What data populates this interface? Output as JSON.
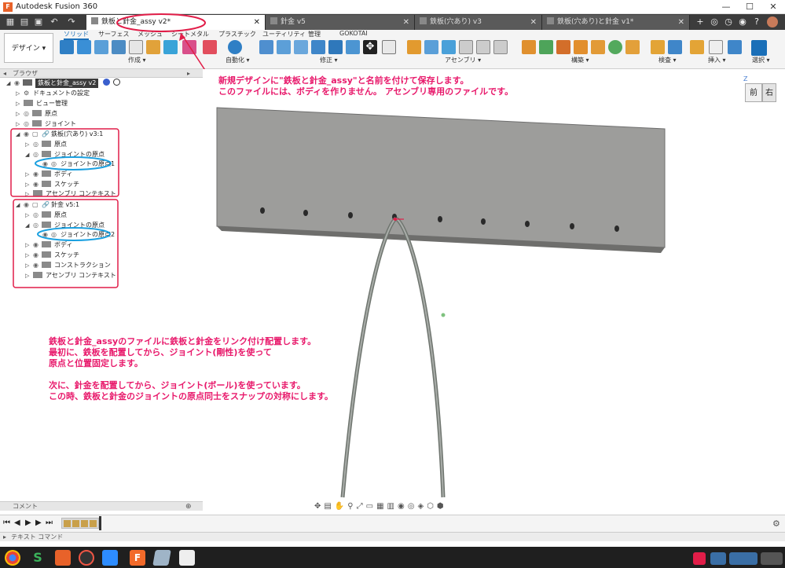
{
  "window": {
    "app_title": "Autodesk Fusion 360",
    "controls": {
      "minimize": "—",
      "maximize": "☐",
      "close": "✕"
    }
  },
  "tabs": [
    {
      "label": "鉄板と針金_assy v2*",
      "active": true
    },
    {
      "label": "針金 v5",
      "active": false
    },
    {
      "label": "鉄板(穴あり) v3",
      "active": false
    },
    {
      "label": "鉄板(穴あり)と針金 v1*",
      "active": false
    }
  ],
  "ribbon": {
    "design_label": "デザイン ▾",
    "tabs": [
      "ソリッド",
      "サーフェス",
      "メッシュ",
      "シートメタル",
      "プラスチック",
      "ユーティリティ",
      "管理",
      "GOKOTAI"
    ],
    "groups": [
      "作成 ▾",
      "自動化 ▾",
      "修正 ▾",
      "アセンブリ ▾",
      "構築 ▾",
      "検査 ▾",
      "挿入 ▾",
      "選択 ▾"
    ]
  },
  "browser": {
    "title": "ブラウザ",
    "root_label": "鉄板と針金_assy v2",
    "items": [
      {
        "label": "ドキュメントの設定"
      },
      {
        "label": "ビュー管理"
      },
      {
        "label": "原点"
      },
      {
        "label": "ジョイント"
      },
      {
        "label": "鉄板(穴あり) v3:1"
      },
      {
        "label": "原点"
      },
      {
        "label": "ジョイントの原点"
      },
      {
        "label": "ジョイントの原点1"
      },
      {
        "label": "ボディ"
      },
      {
        "label": "スケッチ"
      },
      {
        "label": "アセンブリ コンテキスト"
      },
      {
        "label": "針金 v5:1"
      },
      {
        "label": "原点"
      },
      {
        "label": "ジョイントの原点"
      },
      {
        "label": "ジョイントの原点2"
      },
      {
        "label": "ボディ"
      },
      {
        "label": "スケッチ"
      },
      {
        "label": "コンストラクション"
      },
      {
        "label": "アセンブリ コンテキスト"
      }
    ]
  },
  "annotations": {
    "top": "新規デザインに\"鉄板と針金_assy\"と名前を付けて保存します。\nこのファイルには、ボディを作りません。 アセンブリ専用のファイルです。",
    "bottom": "鉄板と針金_assyのファイルに鉄板と針金をリンク付け配置します。\n最初に、鉄板を配置してから、ジョイント(剛性)を使って\n原点と位置固定します。\n\n次に、針金を配置してから、ジョイント(ボール)を使っています。\nこの時、鉄板と針金のジョイントの原点同士をスナップの対称にします。"
  },
  "viewcube": {
    "front": "前",
    "right": "右",
    "axis_z": "Z"
  },
  "comment_label": "コメント",
  "text_command_label": "テキスト コマンド",
  "colors": {
    "annotation": "#e8196b",
    "highlight_red": "#e11d48",
    "highlight_blue": "#1aa0e0",
    "plate": "#9a9a9a"
  }
}
